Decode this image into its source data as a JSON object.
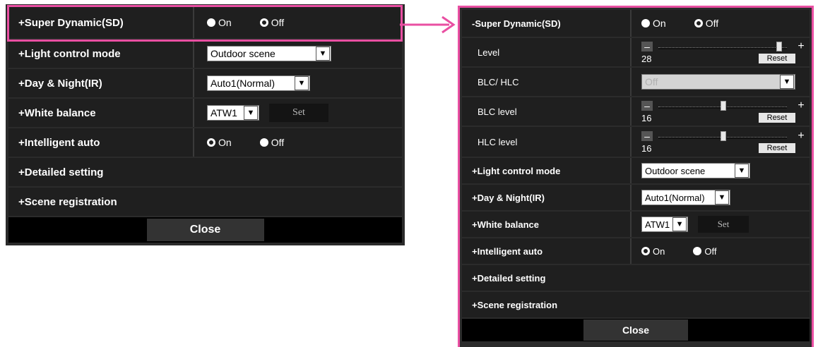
{
  "left_panel": {
    "rows": [
      {
        "label": "+Super Dynamic(SD)",
        "on": "On",
        "off": "Off"
      },
      {
        "label": "+Light control mode",
        "value": "Outdoor scene"
      },
      {
        "label": "+Day & Night(IR)",
        "value": "Auto1(Normal)"
      },
      {
        "label": "+White balance",
        "value": "ATW1",
        "set": "Set"
      },
      {
        "label": "+Intelligent auto",
        "on": "On",
        "off": "Off"
      },
      {
        "label": "+Detailed setting"
      },
      {
        "label": "+Scene registration"
      }
    ],
    "close": "Close"
  },
  "right_panel": {
    "super_dynamic": {
      "label": "-Super Dynamic(SD)",
      "on": "On",
      "off": "Off"
    },
    "level": {
      "label": "Level",
      "value": "28",
      "position": 0.93,
      "reset": "Reset",
      "plus": "+"
    },
    "blc_hlc": {
      "label": "BLC/ HLC",
      "value": "Off"
    },
    "blc_level": {
      "label": "BLC level",
      "value": "16",
      "position": 0.5,
      "reset": "Reset",
      "plus": "+"
    },
    "hlc_level": {
      "label": "HLC level",
      "value": "16",
      "position": 0.5,
      "reset": "Reset",
      "plus": "+"
    },
    "light_control": {
      "label": "+Light control mode",
      "value": "Outdoor scene"
    },
    "day_night": {
      "label": "+Day & Night(IR)",
      "value": "Auto1(Normal)"
    },
    "white_balance": {
      "label": "+White balance",
      "value": "ATW1",
      "set": "Set"
    },
    "intelligent_auto": {
      "label": "+Intelligent auto",
      "on": "On",
      "off": "Off"
    },
    "detailed_setting": {
      "label": "+Detailed setting"
    },
    "scene_registration": {
      "label": "+Scene registration"
    },
    "close": "Close"
  },
  "colors": {
    "highlight": "#e94fa2",
    "panel_bg": "#2b2b2b",
    "row_bg": "#1f1f1f"
  },
  "icons": {
    "chevron": "chevron-down-icon",
    "arrow": "arrow-right-icon"
  }
}
